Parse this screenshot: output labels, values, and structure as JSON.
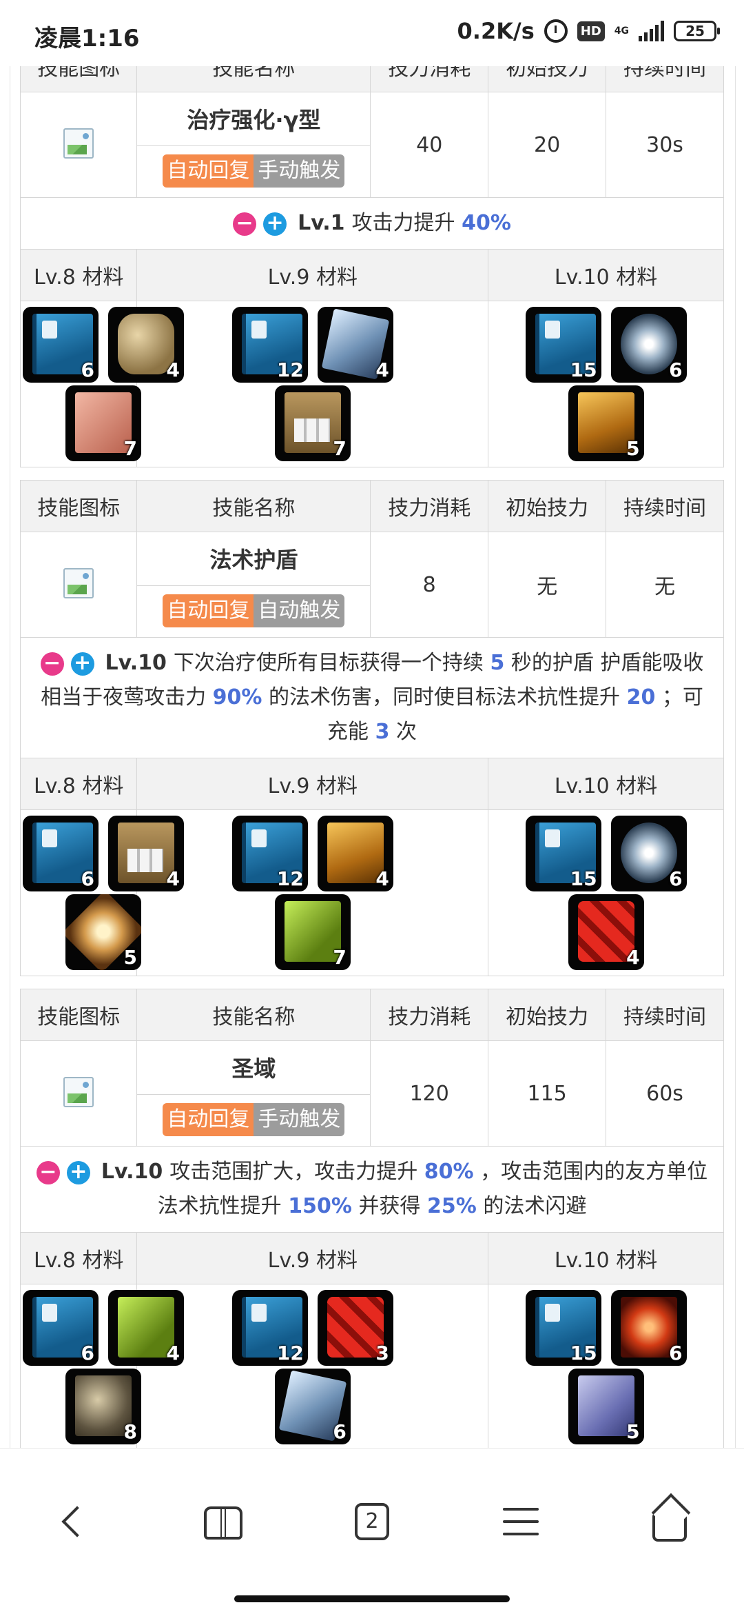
{
  "status_bar": {
    "time": "凌晨1:16",
    "speed": "0.2K/s",
    "hd": "HD",
    "net": "4G",
    "battery": "25"
  },
  "skill_headers": [
    "技能图标",
    "技能名称",
    "技力消耗",
    "初始技力",
    "持续时间"
  ],
  "material_headers": [
    "Lv.8 材料",
    "Lv.9 材料",
    "Lv.10 材料"
  ],
  "skills": [
    {
      "name": "治疗强化·γ型",
      "tags": [
        "自动回复",
        "手动触发"
      ],
      "sp_cost": "40",
      "initial_sp": "20",
      "duration": "30s",
      "desc": {
        "level": "Lv.1",
        "parts": [
          "攻击力提升",
          "40%"
        ]
      },
      "materials": [
        [
          {
            "art": "book",
            "count": "6"
          },
          {
            "art": "hex",
            "count": "4"
          },
          {
            "art": "pink",
            "count": "7"
          }
        ],
        [
          {
            "art": "book",
            "count": "12"
          },
          {
            "art": "crystal",
            "count": "4"
          },
          {
            "art": "box",
            "count": "7"
          }
        ],
        [
          {
            "art": "book",
            "count": "15"
          },
          {
            "art": "spiral",
            "count": "6"
          },
          {
            "art": "gold",
            "count": "5"
          }
        ]
      ]
    },
    {
      "name": "法术护盾",
      "tags": [
        "自动回复",
        "自动触发"
      ],
      "sp_cost": "8",
      "initial_sp": "无",
      "duration": "无",
      "desc": {
        "level": "Lv.10",
        "parts": [
          "下次治疗使所有目标获得一个持续",
          "5",
          "秒的护盾 护盾能吸收相当于夜莺攻击力",
          "90%",
          "的法术伤害，同时使目标法术抗性提升",
          "20",
          "；可充能",
          "3",
          "次"
        ]
      },
      "materials": [
        [
          {
            "art": "book",
            "count": "6"
          },
          {
            "art": "box",
            "count": "4"
          },
          {
            "art": "star",
            "count": "5"
          }
        ],
        [
          {
            "art": "book",
            "count": "12"
          },
          {
            "art": "gold",
            "count": "4"
          },
          {
            "art": "green",
            "count": "7"
          }
        ],
        [
          {
            "art": "book",
            "count": "15"
          },
          {
            "art": "spiral",
            "count": "6"
          },
          {
            "art": "red",
            "count": "4"
          }
        ]
      ]
    },
    {
      "name": "圣域",
      "tags": [
        "自动回复",
        "手动触发"
      ],
      "sp_cost": "120",
      "initial_sp": "115",
      "duration": "60s",
      "desc": {
        "level": "Lv.10",
        "parts": [
          "攻击范围扩大，攻击力提升",
          "80%",
          "，攻击范围内的友方单位法术抗性提升",
          "150%",
          "并获得",
          "25%",
          "的法术闪避"
        ]
      },
      "materials": [
        [
          {
            "art": "book",
            "count": "6"
          },
          {
            "art": "green",
            "count": "4"
          },
          {
            "art": "rock",
            "count": "8"
          }
        ],
        [
          {
            "art": "book",
            "count": "12"
          },
          {
            "art": "red",
            "count": "3"
          },
          {
            "art": "crystal",
            "count": "6"
          }
        ],
        [
          {
            "art": "book",
            "count": "15"
          },
          {
            "art": "redglow",
            "count": "6"
          },
          {
            "art": "cube",
            "count": "5"
          }
        ]
      ]
    }
  ],
  "nav": {
    "tabs_count": "2",
    "icons": [
      "back-icon",
      "bookmarks-icon",
      "tabs-icon",
      "menu-icon",
      "home-icon"
    ]
  }
}
